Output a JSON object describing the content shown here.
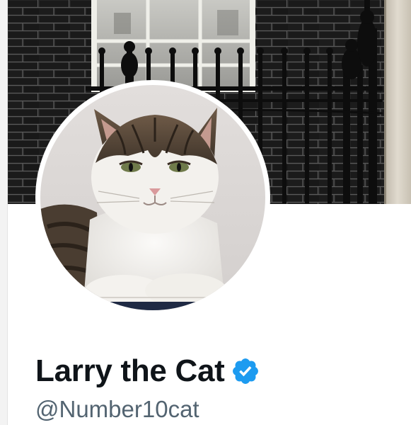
{
  "profile": {
    "display_name": "Larry the Cat",
    "handle": "@Number10cat",
    "verified_badge_icon": "verified-badge-icon"
  },
  "banner": {
    "description_icon": "door-railings-banner-image"
  },
  "avatar": {
    "icon": "cat-avatar-image"
  },
  "colors": {
    "name_text": "#0f1419",
    "handle_text": "#536471",
    "verified_blue": "#1d9bf0",
    "banner_brick": "#1d1d1d"
  }
}
